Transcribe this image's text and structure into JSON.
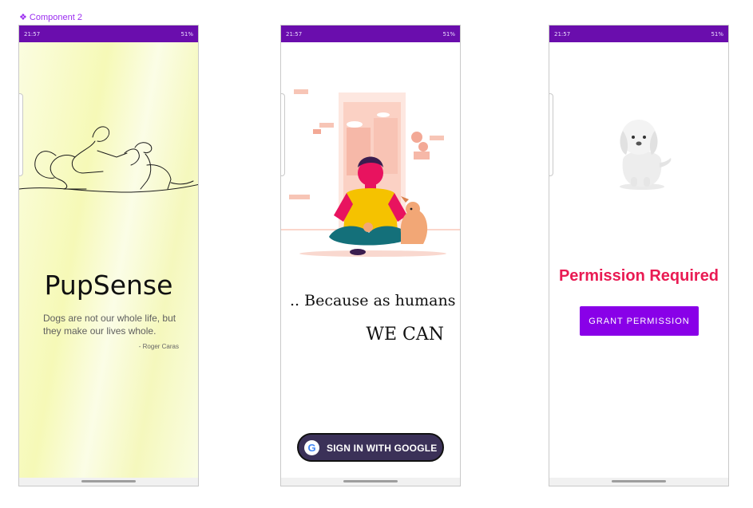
{
  "frame": {
    "label": "❖ Component 2"
  },
  "status_bar": {
    "time": "21:57",
    "right": "51%"
  },
  "screen1": {
    "title": "PupSense",
    "quote": "Dogs are not our whole life, but they make our lives whole.",
    "author": "- Roger Caras"
  },
  "screen2": {
    "line1": ".. Because as humans",
    "line2": "WE CAN",
    "google_button": "SIGN IN WITH GOOGLE",
    "google_letter": "G"
  },
  "screen3": {
    "title": "Permission Required",
    "grant_button": "GRANT PERMISSION"
  },
  "colors": {
    "status_bar": "#6a0dad",
    "accent": "#8900e8",
    "permission_text": "#e91b53",
    "google_button": "#3b3158"
  },
  "icons": [
    "line-art-dog-illustration",
    "person-with-dog-illustration",
    "white-puppy-illustration",
    "google-icon"
  ]
}
